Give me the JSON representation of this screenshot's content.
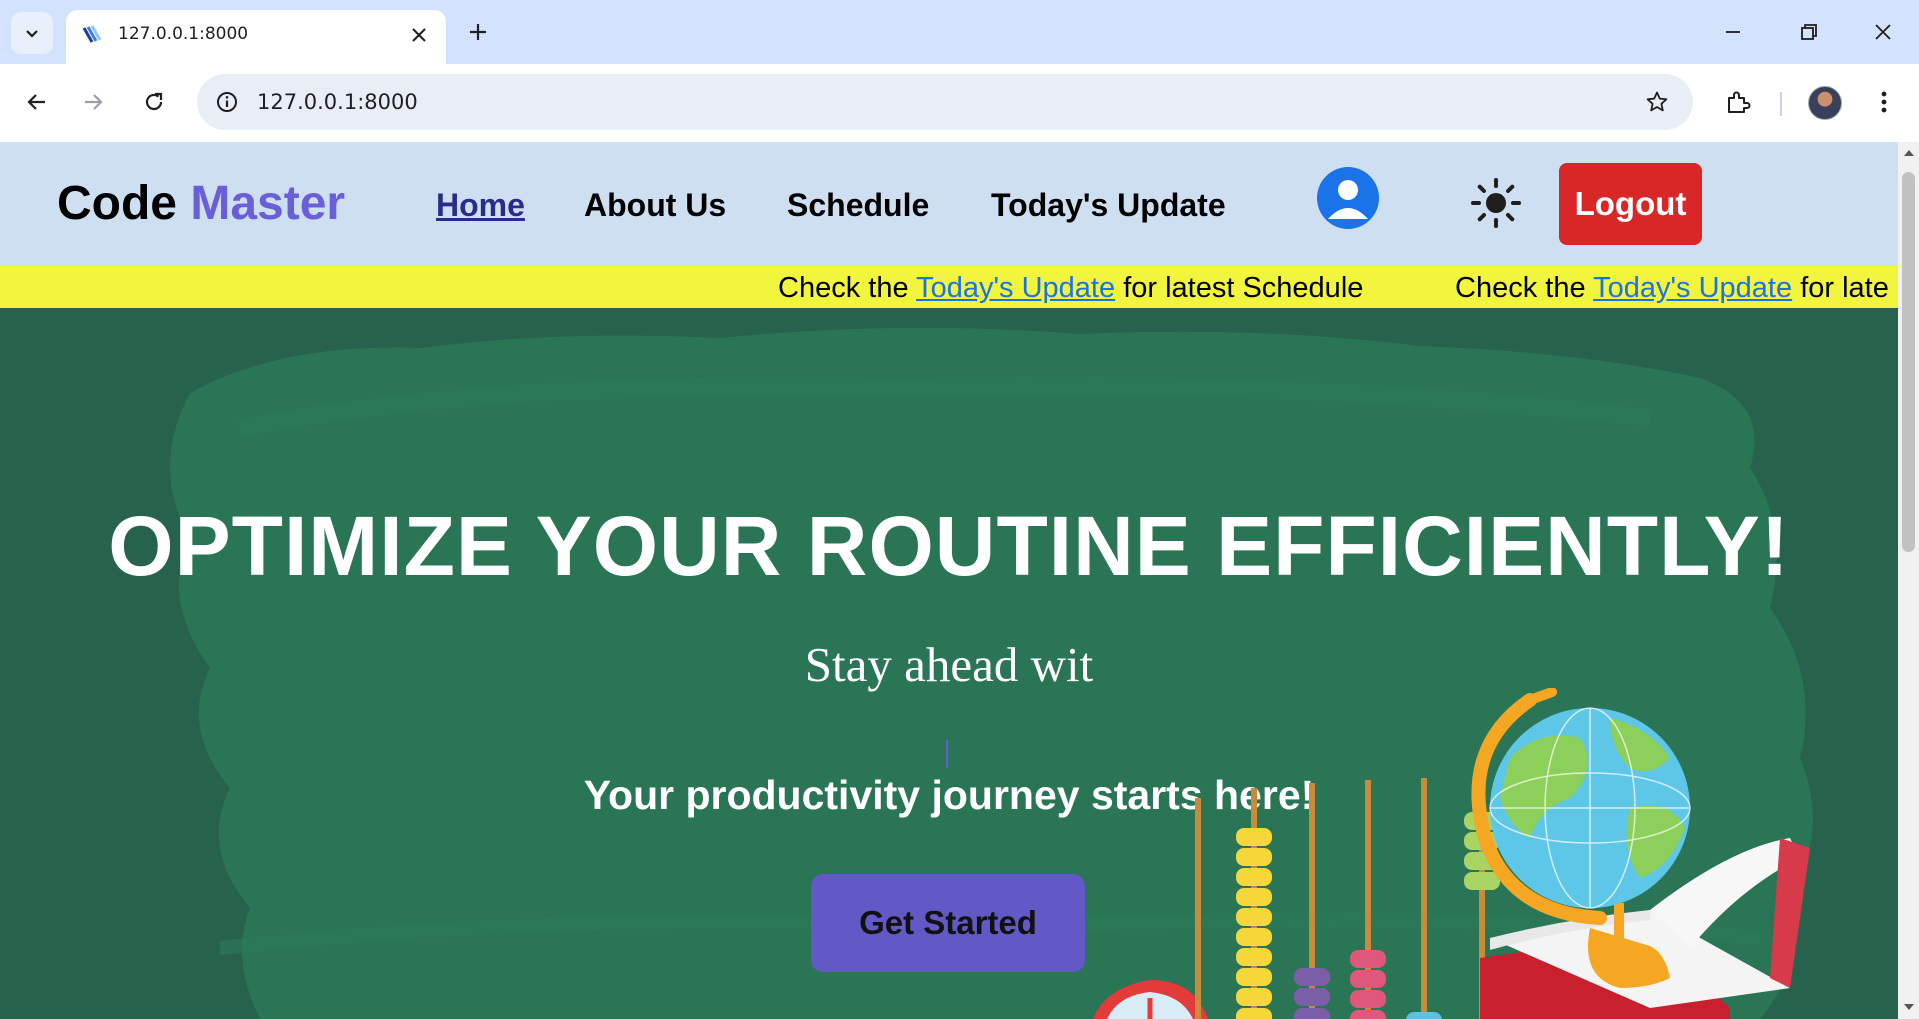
{
  "browser": {
    "tab_title": "127.0.0.1:8000",
    "url": "127.0.0.1:8000",
    "icons": [
      "tab-search-icon",
      "favicon-icon",
      "close-icon",
      "plus-icon",
      "minimize-icon",
      "restore-icon",
      "window-close-icon",
      "back-icon",
      "forward-icon",
      "reload-icon",
      "info-icon",
      "star-icon",
      "extensions-icon",
      "profile-avatar",
      "menu-kebab-icon"
    ]
  },
  "site": {
    "brand_first": "Code",
    "brand_second": "Master",
    "nav": {
      "home": "Home",
      "about": "About Us",
      "schedule": "Schedule",
      "update": "Today's Update"
    },
    "logout_label": "Logout",
    "colors": {
      "nav_bg": "#cfdff2",
      "brand_accent": "#6a5fd8",
      "logout": "#d92626",
      "ticker_bg": "#f2f53d",
      "hero_bg": "#27634c",
      "cta": "#6258c6"
    }
  },
  "ticker": {
    "prefix": "Check the",
    "link": "Today's Update",
    "suffix": "for latest Schedule",
    "suffix_partial": "for late"
  },
  "hero": {
    "title": "OPTIMIZE YOUR ROUTINE EFFICIENTLY!",
    "typing_text": "Stay ahead wit",
    "tagline": "Your productivity journey starts here!",
    "cta_label": "Get Started"
  }
}
